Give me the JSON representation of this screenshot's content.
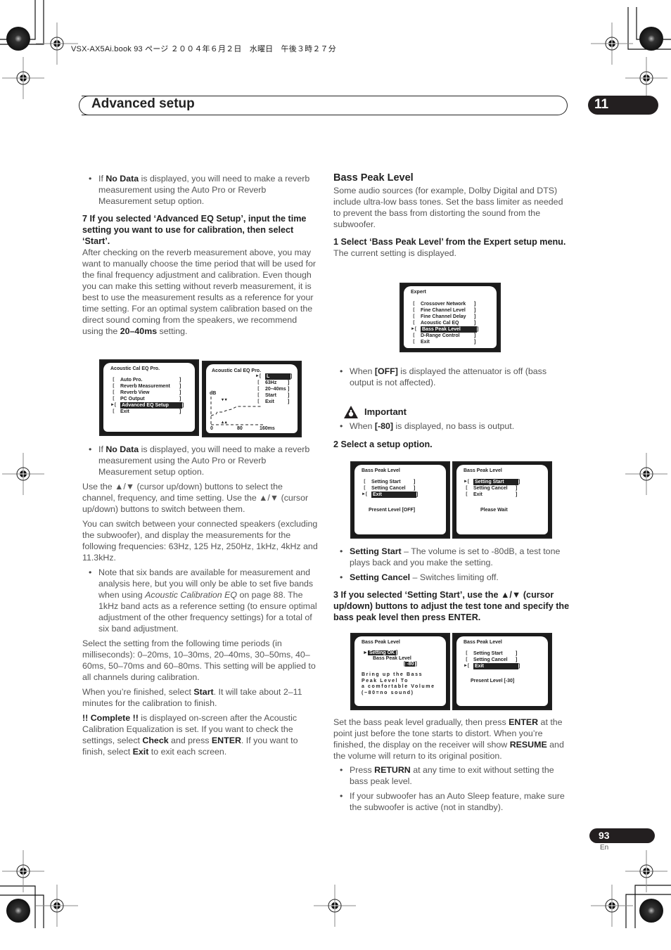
{
  "header": {
    "book_line": "VSX-AX5Ai.book  93 ページ  ２００４年６月２日　水曜日　午後３時２７分",
    "section_title": "Advanced setup",
    "chapter_number": "11"
  },
  "footer": {
    "page_number": "93",
    "language": "En"
  },
  "left_column": {
    "bullet_nodata_1": {
      "prefix": "If ",
      "bold": "No Data",
      "rest": " is displayed, you will need to make a reverb measurement using the Auto Pro or Reverb Measurement setup option."
    },
    "step7_heading": "7    If you selected ‘Advanced EQ Setup’, input the time setting you want to use for calibration, then select ‘Start’.",
    "step7_body": {
      "text": "After checking on the reverb measurement above, you may want to manually choose the time period that will be used for the final frequency adjustment and calibration. Even though you can make this setting without reverb measurement, it is best to use the measurement results as a reference for your time setting. For an optimal system calibration based on the direct sound coming from the speakers, we recommend using the ",
      "bold": "20–40ms",
      "tail": " setting."
    },
    "bullet_nodata_2": {
      "prefix": "If ",
      "bold": "No Data",
      "rest": " is displayed, you will need to make a reverb measurement using the Auto Pro or Reverb Measurement setup option."
    },
    "para_cursor": "Use the ▲/▼ (cursor up/down) buttons to select the channel, frequency, and time setting. Use the ▲/▼ (cursor up/down) buttons to switch between them.",
    "para_speakers": "You can switch between your connected speakers (excluding the subwoofer), and display the measurements for the following frequencies: 63Hz, 125 Hz, 250Hz, 1kHz, 4kHz and 11.3kHz.",
    "bullet_bands": {
      "pre": "Note that six bands are available for measurement and analysis here, but you will only be able to set five bands when using ",
      "italic": "Acoustic Calibration EQ",
      "post": " on page 88. The 1kHz band acts as a reference setting (to ensure optimal adjustment of the other frequency settings) for a total of six band adjustment."
    },
    "para_time_periods": "Select the setting from the following time periods (in milliseconds): 0–20ms, 10–30ms, 20–40ms, 30–50ms, 40–60ms, 50–70ms and 60–80ms. This setting will be applied to all channels during calibration.",
    "para_start": {
      "pre": "When you’re finished, select ",
      "bold": "Start",
      "post": ". It will take about 2–11 minutes for the calibration to finish."
    },
    "para_complete": {
      "b1": "!! Complete !!",
      "t1": " is displayed on-screen after the Acoustic Calibration Equalization is set. If you want to check the settings, select ",
      "b2": "Check",
      "t2": " and press ",
      "b3": "ENTER",
      "t3": ". If you want to finish, select ",
      "b4": "Exit",
      "t4": " to exit each screen."
    }
  },
  "screens": {
    "acoustic_menu": {
      "title": "Acoustic  Cal  EQ  Pro.",
      "items": [
        "Auto Pro.",
        "Reverb Measurement",
        "Reverb View",
        "PC Output",
        "Advanced EQ Setup",
        "Exit"
      ],
      "selected_index": 4
    },
    "acoustic_setup": {
      "title": "Acoustic  Cal  EQ  Pro.",
      "items": [
        "L",
        "63Hz",
        "20–40ms",
        "Start",
        "Exit"
      ],
      "selected_index": 0,
      "y_label": "dB",
      "x_ticks": [
        "0",
        "80",
        "160ms"
      ]
    },
    "expert_menu": {
      "title": "Expert",
      "items": [
        "Crossover Network",
        "Fine Channel Level",
        "Fine Channel Delay",
        "Acoustic Cal EQ",
        "Bass Peak Level",
        "D-Range Control",
        "Exit"
      ],
      "selected_index": 4
    },
    "bpl_exit": {
      "title": "Bass  Peak  Level",
      "items": [
        "Setting Start",
        "Setting Cancel",
        "Exit"
      ],
      "selected_index": 2,
      "status": "Present Level  [OFF]"
    },
    "bpl_wait": {
      "title": "Bass  Peak  Level",
      "items": [
        "Setting Start",
        "Setting Cancel",
        "Exit"
      ],
      "selected_index": 0,
      "status": "Please Wait"
    },
    "bpl_adjust": {
      "title": "Bass  Peak  Level",
      "selected_item": "Setting  OK",
      "level_label": "Bass  Peak  Level",
      "level_value": "-80",
      "instruction": [
        "Bring up the Bass",
        "Peak Level To",
        "a comfortable Volume",
        "(−80=no sound)"
      ]
    },
    "bpl_done": {
      "title": "Bass  Peak  Level",
      "items": [
        "Setting Start",
        "Setting Cancel",
        "Exit"
      ],
      "selected_index": 2,
      "status": "Present Level [-30]"
    }
  },
  "right_column": {
    "heading": "Bass Peak Level",
    "intro": "Some audio sources (for example, Dolby Digital and DTS) include ultra-low bass tones. Set the bass limiter as needed to prevent the bass from distorting the sound from the subwoofer.",
    "step1_heading": "1    Select ‘Bass Peak Level’ from the Expert setup menu.",
    "step1_body": "The current setting is displayed.",
    "bullet_off": {
      "pre": "When ",
      "bold": "[OFF]",
      "post": " is displayed the attenuator is off (bass output is not affected)."
    },
    "important_label": "Important",
    "bullet_80": {
      "pre": "When ",
      "bold": "[-80]",
      "post": " is displayed, no bass is output."
    },
    "step2_heading": "2    Select a setup option.",
    "bullet_start": {
      "bold": "Setting Start",
      "post": " – The volume is set to -80dB, a test tone plays back and you make the setting."
    },
    "bullet_cancel": {
      "bold": "Setting Cancel",
      "post": " – Switches limiting off."
    },
    "step3_heading": "3    If you selected ‘Setting Start’, use the ▲/▼ (cursor up/down) buttons to adjust the test tone and specify the bass peak level then press ENTER.",
    "para_enter": {
      "t1": "Set the bass peak level gradually, then press ",
      "b1": "ENTER",
      "t2": " at the point just before the tone starts to distort. When you’re finished, the display on the receiver will show ",
      "b2": "RESUME",
      "t3": " and the volume will return to its original position."
    },
    "bullet_return": {
      "pre": "Press ",
      "bold": "RETURN",
      "post": " at any time to exit without setting the bass peak level."
    },
    "bullet_sleep": "If your subwoofer has an Auto Sleep feature, make sure the subwoofer is active (not in standby)."
  }
}
